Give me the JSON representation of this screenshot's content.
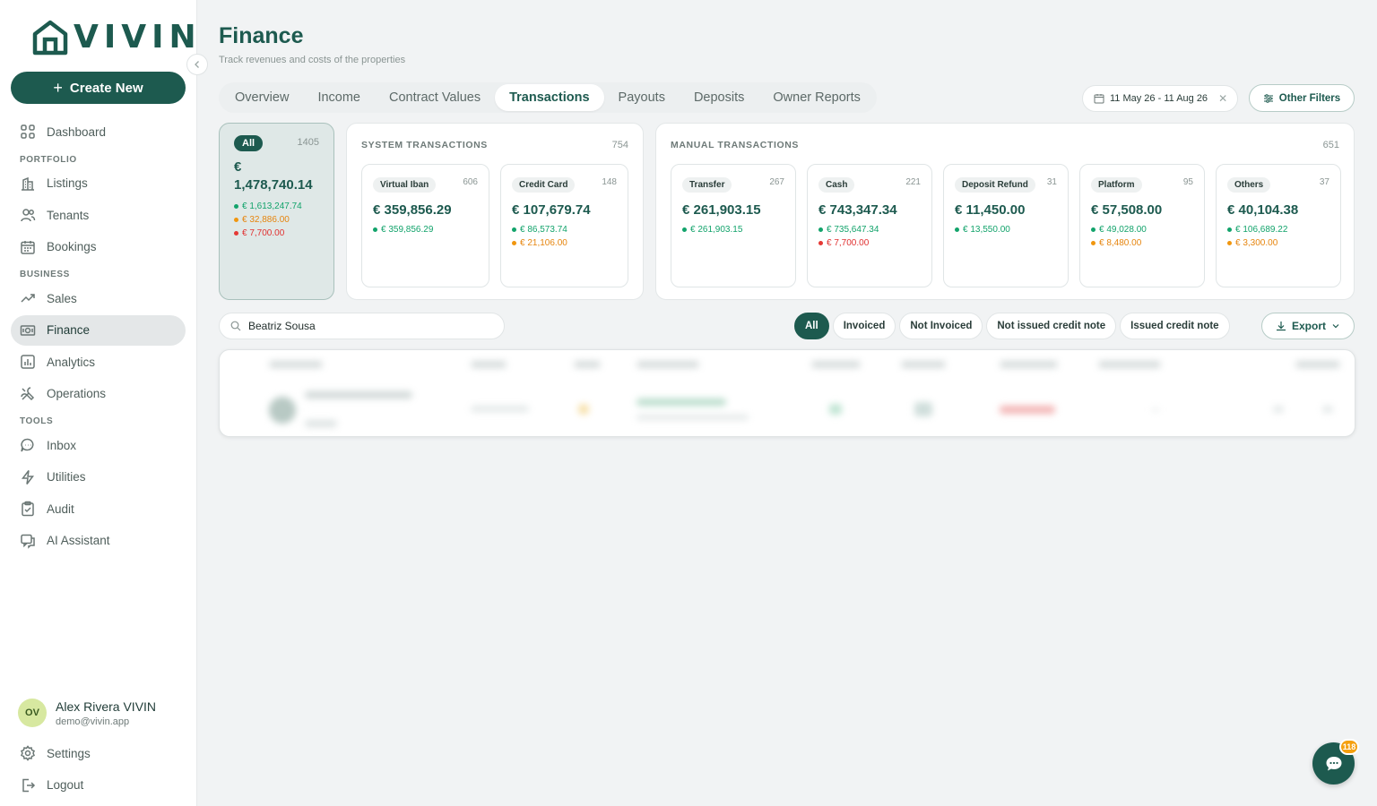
{
  "app": {
    "brand": "VIVIN"
  },
  "sidebar": {
    "create_label": "Create New",
    "items": [
      {
        "label": "Dashboard",
        "icon": "dashboard-icon"
      }
    ],
    "portfolio_section": "PORTFOLIO",
    "portfolio": [
      {
        "label": "Listings",
        "icon": "building-icon"
      },
      {
        "label": "Tenants",
        "icon": "users-icon"
      },
      {
        "label": "Bookings",
        "icon": "calendar-icon"
      }
    ],
    "business_section": "BUSINESS",
    "business": [
      {
        "label": "Sales",
        "icon": "trend-icon"
      },
      {
        "label": "Finance",
        "icon": "money-icon",
        "active": true
      },
      {
        "label": "Analytics",
        "icon": "chart-icon"
      },
      {
        "label": "Operations",
        "icon": "tools-icon"
      }
    ],
    "tools_section": "TOOLS",
    "tools": [
      {
        "label": "Inbox",
        "icon": "chat-icon"
      },
      {
        "label": "Utilities",
        "icon": "bolt-icon"
      },
      {
        "label": "Audit",
        "icon": "clipboard-icon"
      },
      {
        "label": "AI Assistant",
        "icon": "assistant-icon"
      }
    ],
    "user": {
      "initials": "OV",
      "name": "Alex Rivera VIVIN",
      "email": "demo@vivin.app"
    },
    "bottom": [
      {
        "label": "Settings",
        "icon": "gear-icon"
      },
      {
        "label": "Logout",
        "icon": "logout-icon"
      }
    ]
  },
  "header": {
    "title": "Finance",
    "subtitle": "Track revenues and costs of the properties"
  },
  "tabs": [
    "Overview",
    "Income",
    "Contract Values",
    "Transactions",
    "Payouts",
    "Deposits",
    "Owner Reports"
  ],
  "active_tab": "Transactions",
  "filters": {
    "date_range": "11 May 26 - 11 Aug 26",
    "other_filters": "Other Filters"
  },
  "summary": {
    "all": {
      "label": "All",
      "count": "1405",
      "amount": "€ 1,478,740.14",
      "green": "€ 1,613,247.74",
      "orange": "€ 32,886.00",
      "red": "€ 7,700.00"
    },
    "system": {
      "title": "SYSTEM TRANSACTIONS",
      "count": "754",
      "cards": [
        {
          "label": "Virtual Iban",
          "count": "606",
          "amount": "€ 359,856.29",
          "green": "€ 359,856.29"
        },
        {
          "label": "Credit Card",
          "count": "148",
          "amount": "€ 107,679.74",
          "green": "€ 86,573.74",
          "orange": "€ 21,106.00"
        }
      ]
    },
    "manual": {
      "title": "MANUAL TRANSACTIONS",
      "count": "651",
      "cards": [
        {
          "label": "Transfer",
          "count": "267",
          "amount": "€ 261,903.15",
          "green": "€ 261,903.15"
        },
        {
          "label": "Cash",
          "count": "221",
          "amount": "€ 743,347.34",
          "green": "€ 735,647.34",
          "red": "€ 7,700.00"
        },
        {
          "label": "Deposit Refund",
          "count": "31",
          "amount": "€ 11,450.00",
          "green": "€ 13,550.00"
        },
        {
          "label": "Platform",
          "count": "95",
          "amount": "€ 57,508.00",
          "green": "€ 49,028.00",
          "orange": "€ 8,480.00"
        },
        {
          "label": "Others",
          "count": "37",
          "amount": "€ 40,104.38",
          "green": "€ 106,689.22",
          "orange": "€ 3,300.00"
        }
      ]
    }
  },
  "toolbar": {
    "search_value": "Beatriz Sousa",
    "chips": [
      "All",
      "Invoiced",
      "Not Invoiced",
      "Not issued credit note",
      "Issued credit note"
    ],
    "export_label": "Export"
  },
  "chat": {
    "badge": "118"
  },
  "colors": {
    "primary": "#1d5a4f",
    "green": "#12a36b",
    "orange": "#f0960f",
    "red": "#e53935"
  }
}
